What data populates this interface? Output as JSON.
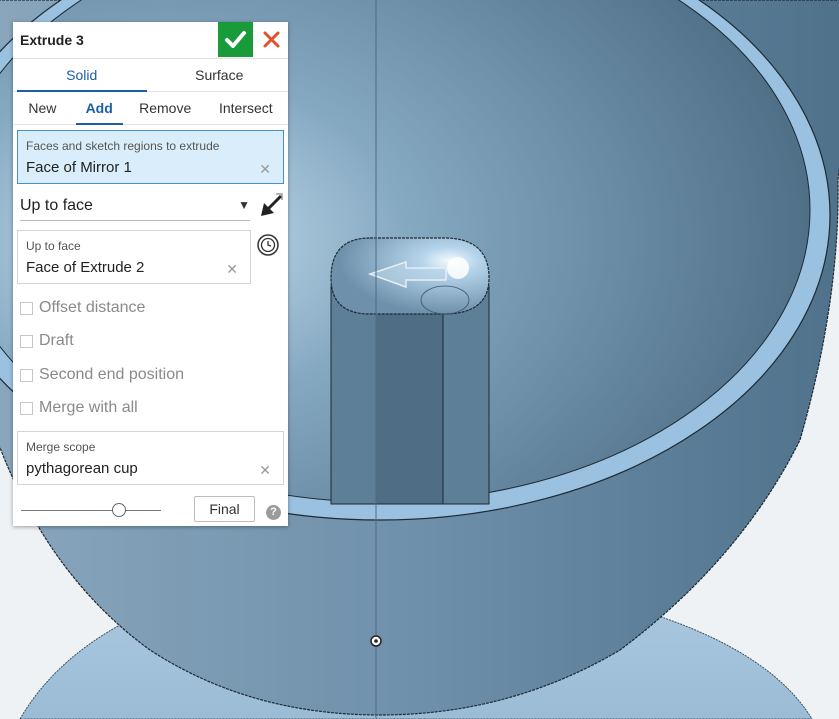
{
  "dialog": {
    "title": "Extrude 3",
    "confirm_icon": "check-icon",
    "cancel_icon": "close-icon",
    "accent_color": "#1a5fa8",
    "confirm_color": "#1a9b3a",
    "cancel_color": "#e2522a"
  },
  "body_type_tabs": [
    {
      "label": "Solid",
      "active": true
    },
    {
      "label": "Surface",
      "active": false
    }
  ],
  "operation_tabs": [
    {
      "label": "New",
      "active": false
    },
    {
      "label": "Add",
      "active": true
    },
    {
      "label": "Remove",
      "active": false
    },
    {
      "label": "Intersect",
      "active": false
    }
  ],
  "faces_field": {
    "label": "Faces and sketch regions to extrude",
    "value": "Face of Mirror 1",
    "clear_icon": "clear-icon"
  },
  "end_type": {
    "value": "Up to face",
    "chevron_icon": "chevron-down-icon",
    "flip_icon": "flip-direction-arrow-icon"
  },
  "up_to_face_field": {
    "label": "Up to face",
    "value": "Face of Extrude 2",
    "clear_icon": "clear-icon",
    "side_icon": "clock-icon"
  },
  "options": [
    {
      "label": "Offset distance",
      "checked": false
    },
    {
      "label": "Draft",
      "checked": false
    },
    {
      "label": "Second end position",
      "checked": false
    },
    {
      "label": "Merge with all",
      "checked": false
    }
  ],
  "merge_scope": {
    "label": "Merge scope",
    "value": "pythagorean cup",
    "clear_icon": "clear-icon"
  },
  "footer": {
    "slider_icon": "rollback-slider",
    "final_label": "Final",
    "help_icon": "help-icon",
    "help_glyph": "?"
  },
  "viewport": {
    "model_color": "#5f86a3",
    "background_color": "#eef2f5"
  }
}
